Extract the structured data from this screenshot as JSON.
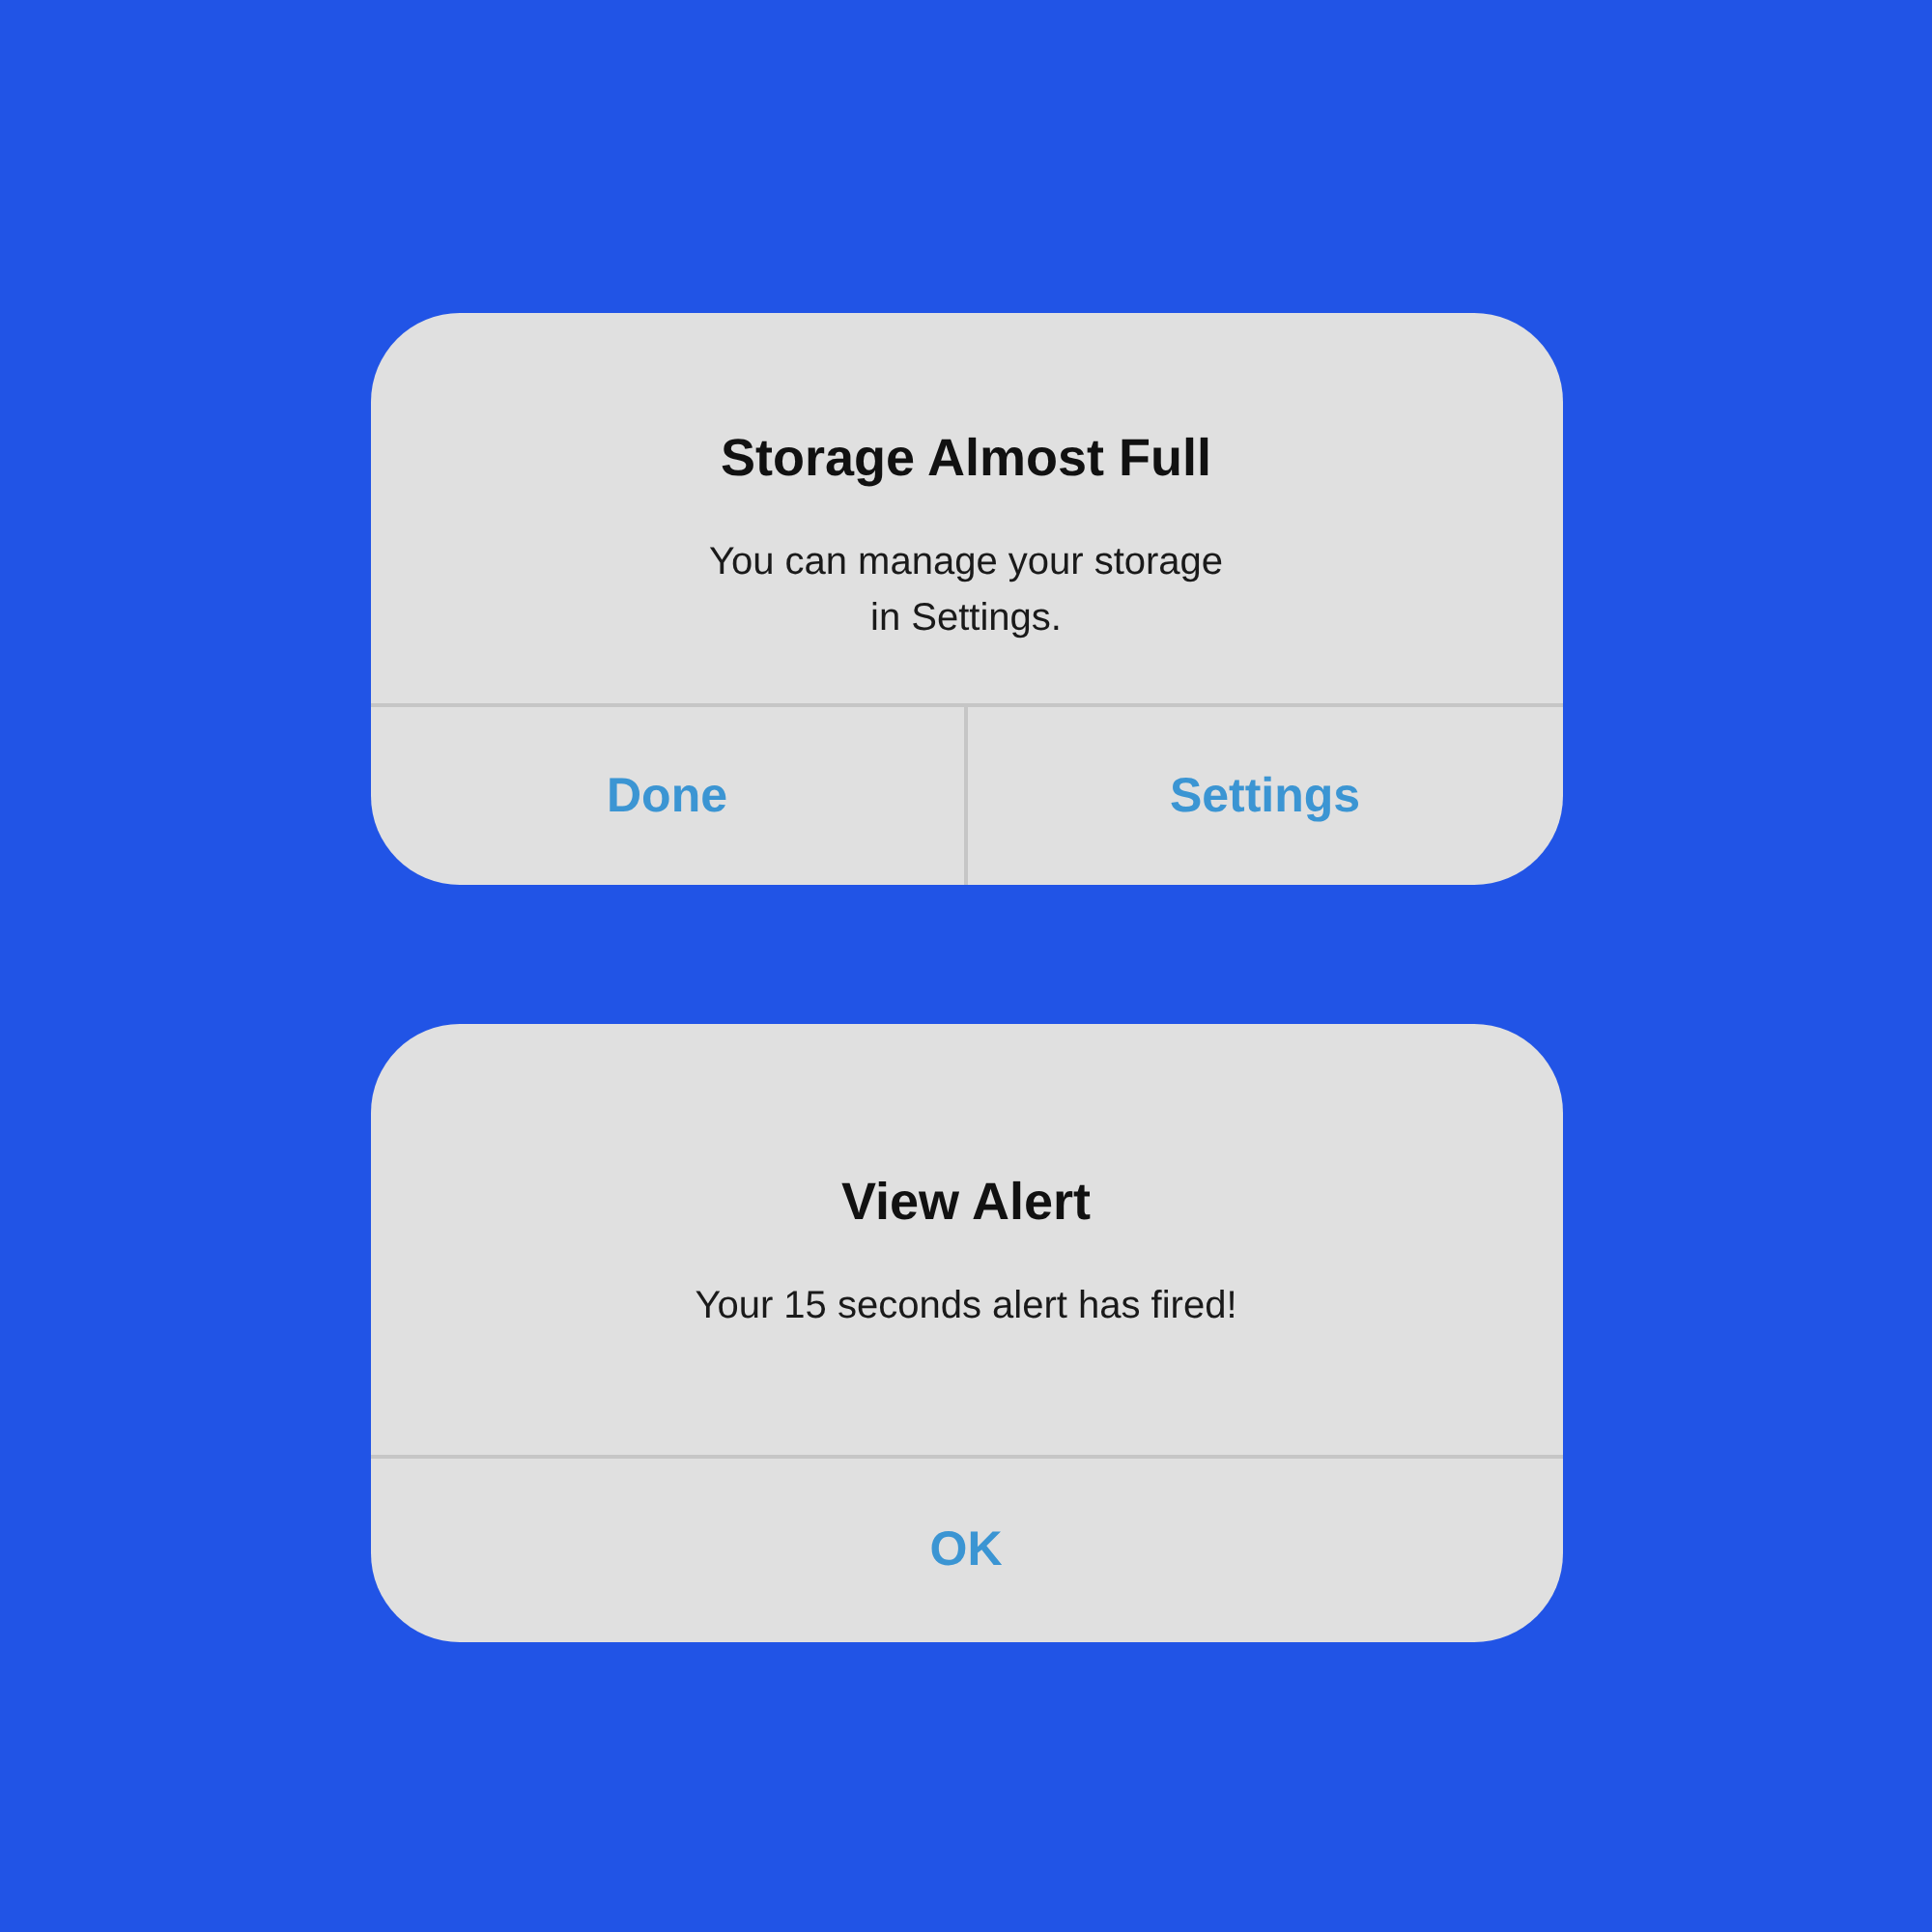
{
  "dialogs": [
    {
      "title": "Storage Almost Full",
      "message": "You can manage your storage\nin Settings.",
      "buttons": [
        {
          "label": "Done"
        },
        {
          "label": "Settings"
        }
      ]
    },
    {
      "title": "View Alert",
      "message": "Your 15 seconds alert has fired!",
      "buttons": [
        {
          "label": "OK"
        }
      ]
    }
  ]
}
